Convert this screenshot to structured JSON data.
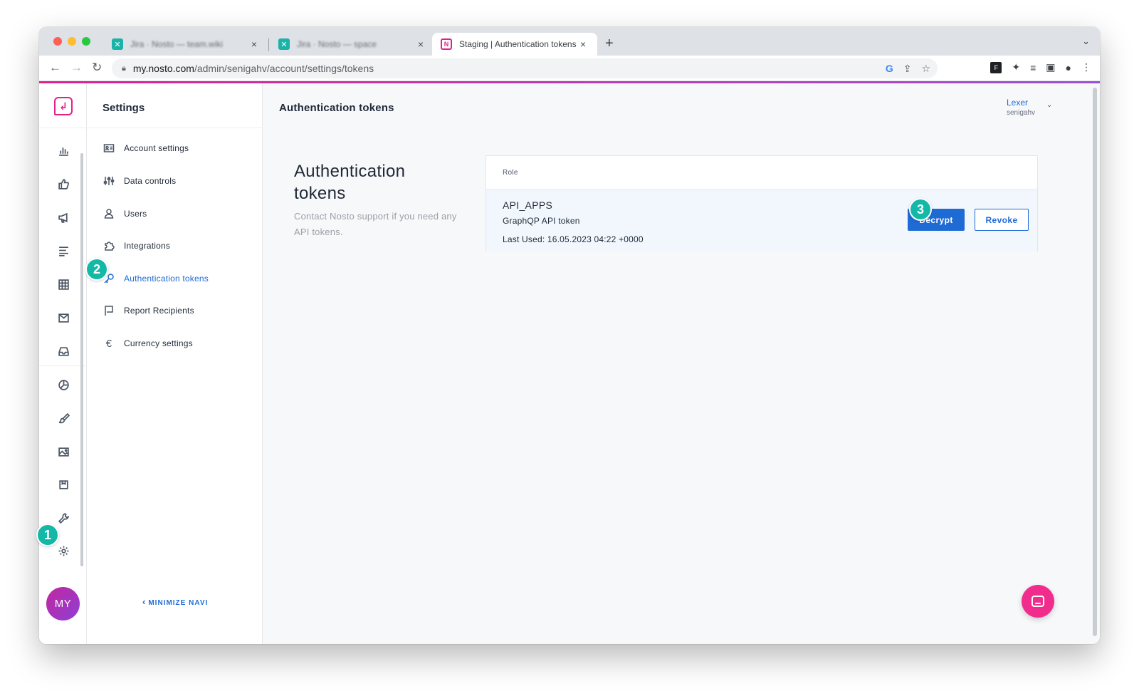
{
  "browser": {
    "tabs": [
      {
        "title": "Jira · Nosto — team.wiki",
        "blurred": true
      },
      {
        "title": "Jira · Nosto — space",
        "blurred": true
      },
      {
        "title": "Staging | Authentication tokens",
        "active": true
      }
    ],
    "url_host": "my.nosto.com",
    "url_path": "/admin/senigahv/account/settings/tokens",
    "new_tab_glyph": "+",
    "close_glyph": "×"
  },
  "rail": {
    "icons": [
      "analytics-icon",
      "thumbs-up-icon",
      "megaphone-icon",
      "list-icon",
      "grid-icon",
      "mail-icon",
      "inbox-icon",
      "segments-icon",
      "brush-icon",
      "image-icon",
      "package-icon",
      "wrench-icon",
      "gear-icon"
    ],
    "avatar_initials": "MY"
  },
  "subnav": {
    "title": "Settings",
    "items": [
      {
        "label": "Account settings",
        "icon": "id-card-icon"
      },
      {
        "label": "Data controls",
        "icon": "sliders-icon"
      },
      {
        "label": "Users",
        "icon": "user-icon"
      },
      {
        "label": "Integrations",
        "icon": "puzzle-icon"
      },
      {
        "label": "Authentication tokens",
        "icon": "key-icon",
        "active": true
      },
      {
        "label": "Report Recipients",
        "icon": "flag-icon"
      },
      {
        "label": "Currency settings",
        "icon": "euro-icon"
      }
    ],
    "minimize_label": "MINIMIZE NAVI",
    "minimize_glyph": "‹"
  },
  "main": {
    "page_title": "Authentication tokens",
    "user": {
      "name": "Lexer",
      "account": "senigahv",
      "chevron": "⌄"
    },
    "section_heading": "Authentication tokens",
    "section_description": "Contact Nosto support if you need any API tokens.",
    "table": {
      "column_header": "Role",
      "token": {
        "name": "API_APPS",
        "description": "GraphQP API token",
        "last_used": "Last Used: 16.05.2023 04:22 +0000"
      },
      "decrypt_label": "Decrypt",
      "revoke_label": "Revoke"
    }
  },
  "annotations": [
    "1",
    "2",
    "3"
  ],
  "colors": {
    "accent_blue": "#1f6bd6",
    "brand_pink": "#e0218a",
    "step_teal": "#14b8a6",
    "chat_pink": "#f02d8c"
  }
}
